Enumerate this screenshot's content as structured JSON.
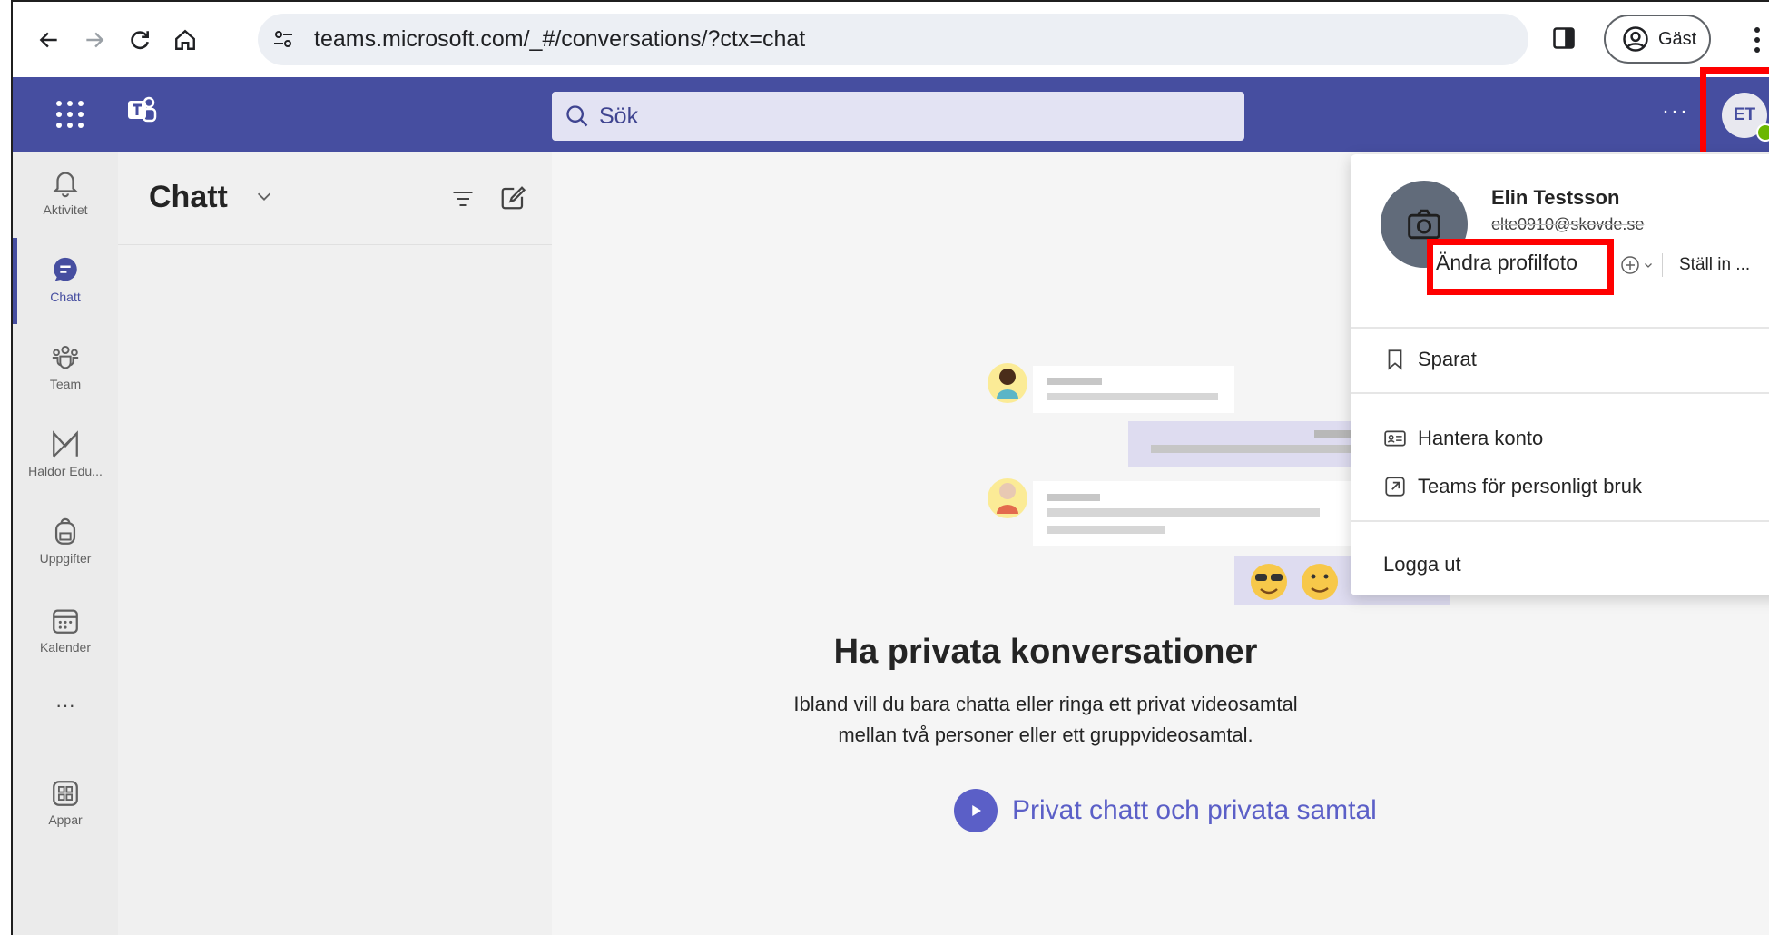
{
  "browser": {
    "url": "teams.microsoft.com/_#/conversations/?ctx=chat",
    "profile_label": "Gäst"
  },
  "header": {
    "search_placeholder": "Sök",
    "more_label": "···",
    "avatar_initials": "ET"
  },
  "rail": {
    "items": [
      {
        "label": "Aktivitet",
        "icon": "bell-icon"
      },
      {
        "label": "Chatt",
        "icon": "chat-icon",
        "active": true
      },
      {
        "label": "Team",
        "icon": "team-icon"
      },
      {
        "label": "Haldor Edu...",
        "icon": "haldor-icon"
      },
      {
        "label": "Uppgifter",
        "icon": "backpack-icon"
      },
      {
        "label": "Kalender",
        "icon": "calendar-icon"
      },
      {
        "label": "···",
        "icon": "more-icon"
      },
      {
        "label": "Appar",
        "icon": "apps-icon"
      }
    ]
  },
  "chat_list": {
    "title": "Chatt"
  },
  "main": {
    "empty_title": "Ha privata konversationer",
    "empty_desc_line1": "Ibland vill du bara chatta eller ringa ett privat videosamtal",
    "empty_desc_line2": "mellan två personer eller ett gruppvideosamtal.",
    "learn_more": "Privat chatt och privata samtal"
  },
  "profile_popup": {
    "name": "Elin Testsson",
    "email": "elte0910@skovde.se",
    "change_photo": "Ändra profilfoto",
    "set_status": "Ställ in ...",
    "items": {
      "saved": "Sparat",
      "manage_account": "Hantera konto",
      "personal_teams": "Teams för personligt bruk",
      "sign_out": "Logga ut"
    }
  },
  "colors": {
    "brand": "#464ea0",
    "accent": "#5b5fc7",
    "highlight": "#ff0000",
    "presence": "#6bb700"
  }
}
